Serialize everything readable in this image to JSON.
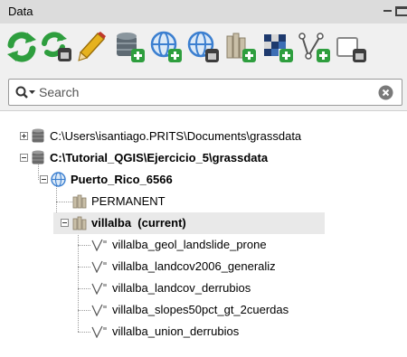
{
  "panel": {
    "title": "Data"
  },
  "toolbar": {
    "buttons": [
      {
        "icon": "sync-icon"
      },
      {
        "icon": "sync-location-icon"
      },
      {
        "icon": "edit-pencil-icon"
      },
      {
        "icon": "new-database-icon"
      },
      {
        "icon": "new-location-icon"
      },
      {
        "icon": "new-location-wizard-icon"
      },
      {
        "icon": "new-mapset-icon"
      },
      {
        "icon": "new-raster-icon"
      },
      {
        "icon": "new-vector-icon"
      },
      {
        "icon": "new-table-icon"
      }
    ]
  },
  "search": {
    "placeholder": "Search",
    "value": ""
  },
  "tree": {
    "databases": [
      {
        "label": "C:\\Users\\isantiago.PRITS\\Documents\\grassdata",
        "expanded": false,
        "bold": false
      },
      {
        "label": "C:\\Tutorial_QGIS\\Ejercicio_5\\grassdata",
        "expanded": true,
        "bold": true
      }
    ],
    "location": {
      "label": "Puerto_Rico_6566"
    },
    "mapsets": [
      {
        "label": "PERMANENT",
        "bold": false
      },
      {
        "label": "villalba  (current)",
        "bold": true
      }
    ],
    "layers": [
      {
        "label": "villalba_geol_landslide_prone"
      },
      {
        "label": "villalba_landcov2006_generaliz"
      },
      {
        "label": "villalba_landcov_derrubios"
      },
      {
        "label": "villalba_slopes50pct_gt_2cuerdas"
      },
      {
        "label": "villalba_union_derrubios"
      }
    ]
  },
  "colors": {
    "accent_green": "#2e9e3e",
    "database_gray": "#6a6a6a",
    "globe_blue": "#3b7fd0",
    "mapset_tan": "#c9bfa8"
  }
}
